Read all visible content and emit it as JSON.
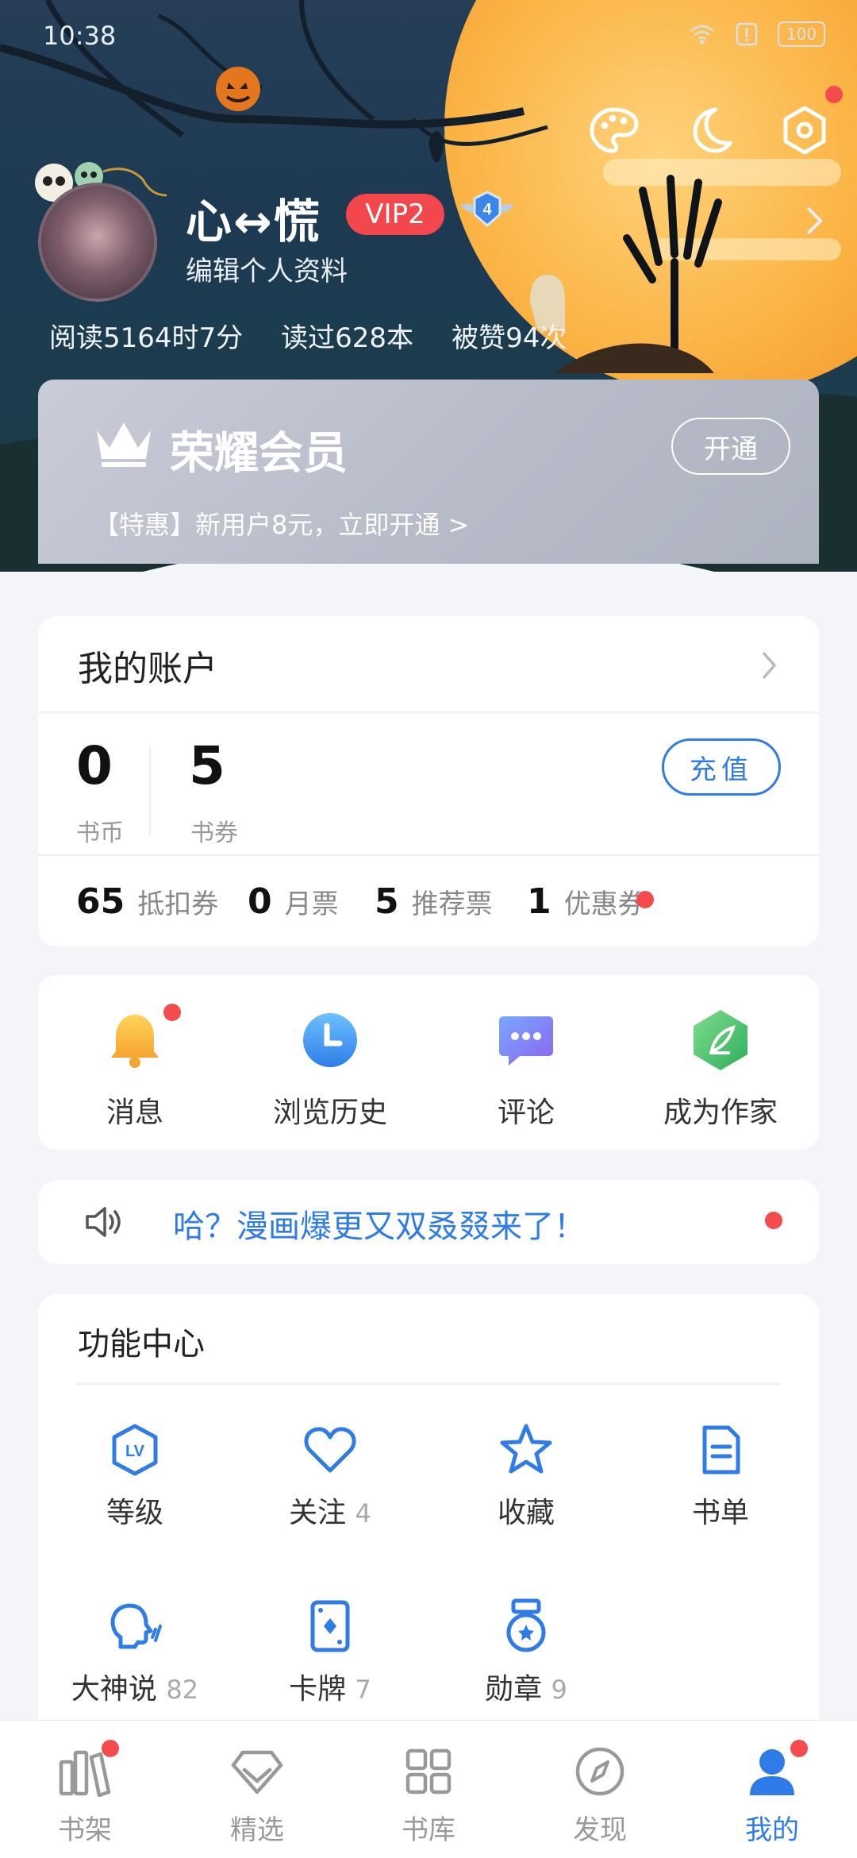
{
  "status_bar": {
    "time": "10:38",
    "battery": "100"
  },
  "profile": {
    "username": "心↔慌",
    "vip_level": "VIP2",
    "badge_level": "4",
    "edit_label": "编辑个人资料",
    "stats": [
      "阅读5164时7分",
      "读过628本",
      "被赞94次"
    ]
  },
  "vip_card": {
    "title": "荣耀会员",
    "open_label": "开通",
    "promo": "【特惠】新用户8元，立即开通 >"
  },
  "account": {
    "title": "我的账户",
    "coins": {
      "value": "0",
      "label": "书币"
    },
    "vouchers": {
      "value": "5",
      "label": "书券"
    },
    "recharge_label": "充值",
    "tickets": [
      {
        "value": "65",
        "label": "抵扣券"
      },
      {
        "value": "0",
        "label": "月票"
      },
      {
        "value": "5",
        "label": "推荐票"
      },
      {
        "value": "1",
        "label": "优惠券"
      }
    ]
  },
  "quick_links": [
    {
      "label": "消息",
      "icon": "bell-icon"
    },
    {
      "label": "浏览历史",
      "icon": "clock-icon"
    },
    {
      "label": "评论",
      "icon": "chat-icon"
    },
    {
      "label": "成为作家",
      "icon": "quill-icon"
    }
  ],
  "notice": {
    "text": "哈？漫画爆更又双叒叕来了！"
  },
  "function_center": {
    "title": "功能中心",
    "items": [
      {
        "label": "等级",
        "count": "",
        "icon": "level-icon"
      },
      {
        "label": "关注",
        "count": "4",
        "icon": "heart-icon"
      },
      {
        "label": "收藏",
        "count": "",
        "icon": "star-icon"
      },
      {
        "label": "书单",
        "count": "",
        "icon": "booklist-icon"
      },
      {
        "label": "大神说",
        "count": "82",
        "icon": "speaking-head-icon"
      },
      {
        "label": "卡牌",
        "count": "7",
        "icon": "card-icon"
      },
      {
        "label": "勋章",
        "count": "9",
        "icon": "medal-icon"
      }
    ]
  },
  "tabs": [
    {
      "label": "书架",
      "icon": "bookshelf-icon"
    },
    {
      "label": "精选",
      "icon": "diamond-icon"
    },
    {
      "label": "书库",
      "icon": "grid-icon"
    },
    {
      "label": "发现",
      "icon": "compass-icon"
    },
    {
      "label": "我的",
      "icon": "user-icon",
      "active": true
    }
  ],
  "colors": {
    "accent": "#2f7ce8",
    "badge_red": "#f34b4e",
    "vip_red": "#f2474c"
  }
}
